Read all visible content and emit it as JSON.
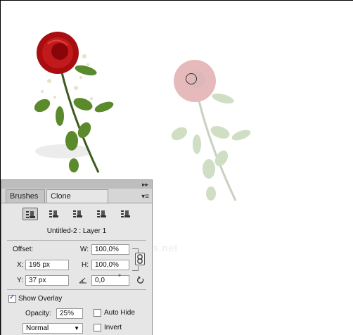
{
  "watermark": "...ders.net",
  "panel": {
    "tabs": [
      {
        "label": "Brushes"
      },
      {
        "label": "Clone Source"
      }
    ],
    "tab_close": "×",
    "collapse": "▸▸",
    "menu": "▾≡",
    "source_buttons": [
      "clone-source-1",
      "clone-source-2",
      "clone-source-3",
      "clone-source-4",
      "clone-source-5"
    ],
    "layer_label": "Untitled-2 : Layer 1",
    "offset_label": "Offset:",
    "x_label": "X:",
    "x_value": "195 px",
    "y_label": "Y:",
    "y_value": "37 px",
    "w_label": "W:",
    "w_value": "100,0%",
    "h_label": "H:",
    "h_value": "100,0%",
    "angle_value": "0,0",
    "degree_symbol": "°",
    "show_overlay_label": "Show Overlay",
    "show_overlay_checked": true,
    "opacity_label": "Opacity:",
    "opacity_value": "25%",
    "auto_hide_label": "Auto Hide",
    "auto_hide_checked": false,
    "invert_label": "Invert",
    "invert_checked": false,
    "blend_mode": "Normal",
    "check_mark": "✓"
  }
}
